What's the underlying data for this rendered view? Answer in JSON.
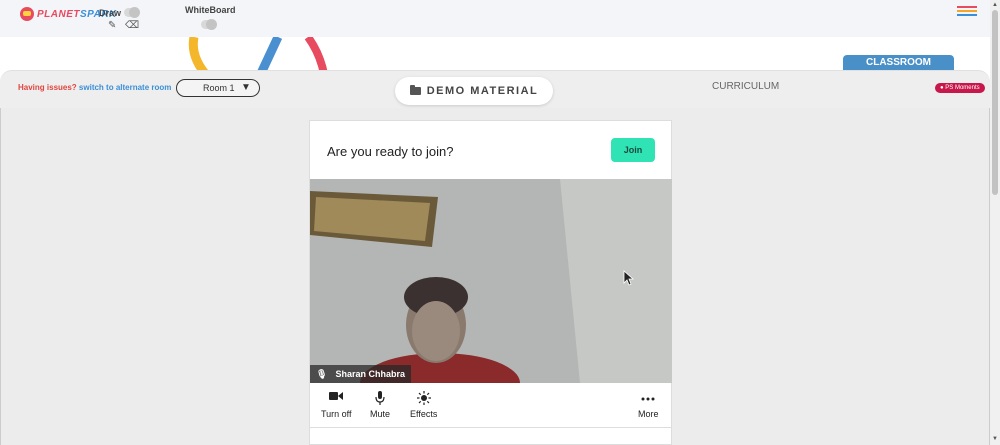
{
  "header": {
    "logo_text_planet": "PLANET",
    "logo_text_spark": "SPARK",
    "draw_label": "Draw",
    "whiteboard_label": "WhiteBoard",
    "icons": [
      "pencil-icon",
      "eraser-icon",
      "menu-icon"
    ]
  },
  "nav": {
    "issues_text": "Having issues?",
    "alternate_link": "switch to alternate room",
    "room_selected": "Room 1",
    "room_arrow": "▼",
    "demo_material": "DEMO MATERIAL",
    "curriculum": "CURRICULUM",
    "classroom": "CLASSROOM",
    "moments": "PS Moments"
  },
  "join_panel": {
    "prompt": "Are you ready to join?",
    "join_label": "Join",
    "participant_name": "Sharan Chhabra",
    "controls": [
      {
        "label": "Turn off",
        "icon": "camera-icon"
      },
      {
        "label": "Mute",
        "icon": "mic-icon"
      },
      {
        "label": "Effects",
        "icon": "effects-icon"
      },
      {
        "label": "More",
        "icon": "more-icon"
      }
    ]
  },
  "colors": {
    "brand_red": "#e84a5f",
    "brand_blue": "#3a8fd8",
    "classroom_tab": "#4a90c8",
    "join_button": "#2fe3b5",
    "moments_badge": "#c8174a"
  }
}
